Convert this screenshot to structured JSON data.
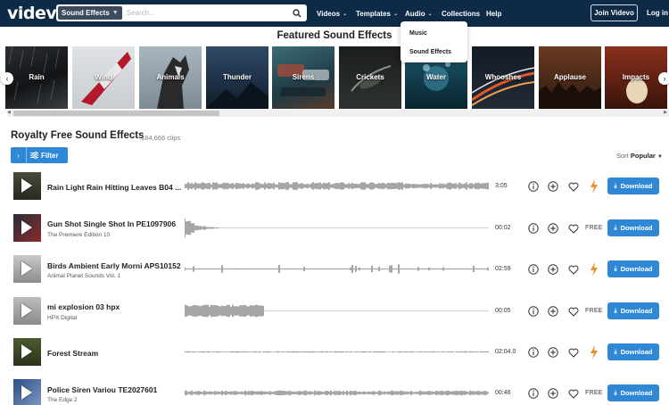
{
  "header": {
    "logo": "videvo",
    "search_category": "Sound Effects",
    "search_placeholder": "Search...",
    "nav": [
      {
        "label": "Videos",
        "dropdown": true
      },
      {
        "label": "Templates",
        "dropdown": true
      },
      {
        "label": "Audio",
        "dropdown": true
      },
      {
        "label": "Collections",
        "dropdown": false
      },
      {
        "label": "Help",
        "dropdown": false
      }
    ],
    "join_label": "Join Videvo",
    "login_label": "Log in",
    "bg_color": "#0d2a47"
  },
  "audio_dropdown": {
    "items": [
      "Music",
      "Sound Effects"
    ]
  },
  "featured": {
    "title": "Featured Sound Effects",
    "tiles": [
      "Rain",
      "Wind",
      "Animals",
      "Thunder",
      "Sirens",
      "Crickets",
      "Water",
      "Whooshes",
      "Applause",
      "Impacts"
    ]
  },
  "section": {
    "title": "Royalty Free Sound Effects",
    "count": "184,666 clips",
    "filter_label": "Filter",
    "sort_label": "Sort",
    "sort_value": "Popular"
  },
  "rows": [
    {
      "title": "Rain Light Rain Hitting Leaves B04 ...",
      "subtitle": "",
      "duration": "3:05",
      "free": false,
      "download_label": "Download"
    },
    {
      "title": "Gun Shot Single Shot In PE1097906",
      "subtitle": "The Premiere Edition 10",
      "duration": "00:02",
      "free": true,
      "download_label": "Download"
    },
    {
      "title": "Birds Ambient Early Morni APS10152",
      "subtitle": "Animal Planet Sounds Vol. 1",
      "duration": "02:59",
      "free": false,
      "download_label": "Download"
    },
    {
      "title": "mi explosion 03 hpx",
      "subtitle": "HPX Digital",
      "duration": "00:05",
      "free": true,
      "download_label": "Download"
    },
    {
      "title": "Forest Stream",
      "subtitle": "",
      "duration": "02:04.0",
      "free": false,
      "download_label": "Download"
    },
    {
      "title": "Police Siren Variou TE2027601",
      "subtitle": "The Edge 2",
      "duration": "00:46",
      "free": true,
      "download_label": "Download"
    }
  ],
  "free_label": "FREE",
  "colors": {
    "accent": "#2f88d6",
    "premium_bolt": "#f08a24"
  }
}
